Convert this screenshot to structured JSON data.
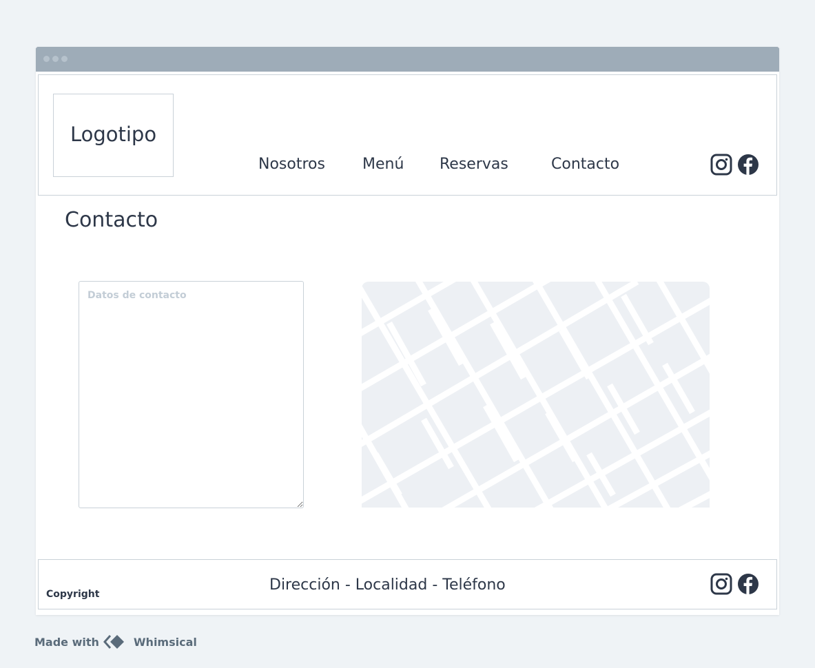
{
  "header": {
    "logo_text": "Logotipo",
    "nav": [
      {
        "label": "Nosotros"
      },
      {
        "label": "Menú"
      },
      {
        "label": "Reservas"
      },
      {
        "label": "Contacto"
      }
    ],
    "social_icons": [
      "instagram-icon",
      "facebook-icon"
    ]
  },
  "main": {
    "title": "Contacto",
    "contact_field": {
      "placeholder": "Datos de contacto",
      "value": ""
    },
    "map_icon": "map-placeholder"
  },
  "footer": {
    "copyright": "Copyright",
    "address": "Dirección - Localidad - Teléfono",
    "social_icons": [
      "instagram-icon",
      "facebook-icon"
    ]
  },
  "watermark": {
    "prefix": "Made with",
    "brand": "Whimsical"
  },
  "colors": {
    "background": "#eff3f6",
    "titlebar": "#9eacb8",
    "border": "#c9d1d8",
    "text": "#2d3748",
    "map_fill": "#edf0f4"
  }
}
